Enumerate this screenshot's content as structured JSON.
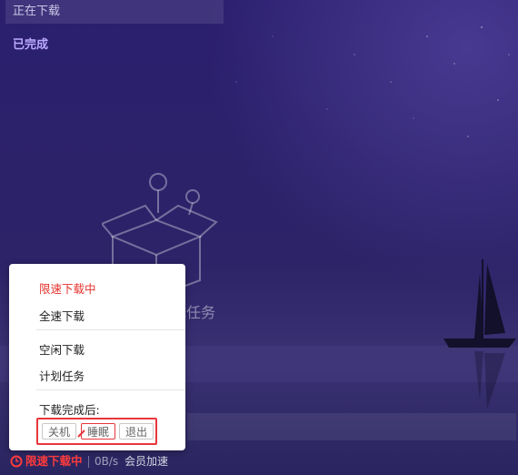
{
  "sidebar": {
    "tabs": [
      {
        "label": "正在下载"
      },
      {
        "label": "已完成"
      }
    ]
  },
  "main": {
    "empty_text": "成任务"
  },
  "speed_menu": {
    "items": [
      {
        "label": "限速下载中",
        "active": true
      },
      {
        "label": "全速下载"
      },
      {
        "label": "空闲下载"
      },
      {
        "label": "计划任务"
      }
    ],
    "after_complete": {
      "label": "下载完成后:",
      "options": [
        "关机",
        "睡眠",
        "退出"
      ],
      "highlighted_option": "睡眠"
    }
  },
  "status_bar": {
    "limit_status": "限速下载中",
    "speed": "0B/s",
    "vip_link": "会员加速"
  },
  "colors": {
    "accent_red": "#e5322d",
    "background": "#2a2166",
    "sidebar_active": "#bba9ff"
  }
}
